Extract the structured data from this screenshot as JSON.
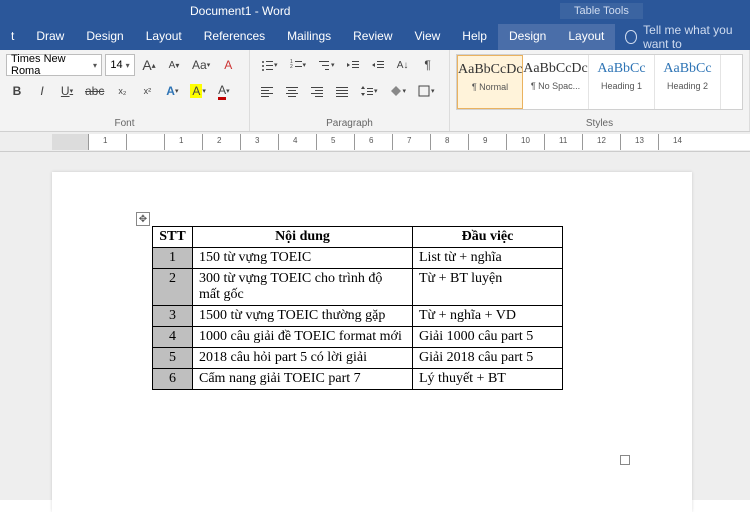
{
  "title": "Document1 - Word",
  "table_tools": "Table Tools",
  "tabs": [
    "t",
    "Draw",
    "Design",
    "Layout",
    "References",
    "Mailings",
    "Review",
    "View",
    "Help"
  ],
  "context_tabs": [
    "Design",
    "Layout"
  ],
  "tellme": "Tell me what you want to",
  "font": {
    "name": "Times New Roma",
    "size": "14",
    "grow": "A",
    "shrink": "A",
    "case": "Aa",
    "clear": "A",
    "bold": "B",
    "italic": "I",
    "underline": "U",
    "strike": "abc",
    "sub": "x₂",
    "sup": "x²",
    "effects": "A",
    "highlight": "A",
    "color": "A",
    "group_label": "Font"
  },
  "paragraph": {
    "group_label": "Paragraph"
  },
  "styles": {
    "group_label": "Styles",
    "items": [
      {
        "preview": "AaBbCcDc",
        "name": "¶ Normal"
      },
      {
        "preview": "AaBbCcDc",
        "name": "¶ No Spac..."
      },
      {
        "preview": "AaBbCc",
        "name": "Heading 1"
      },
      {
        "preview": "AaBbCc",
        "name": "Heading 2"
      }
    ]
  },
  "table": {
    "headers": [
      "STT",
      "Nội dung",
      "Đầu việc"
    ],
    "rows": [
      {
        "stt": "1",
        "nd": "150 từ vựng TOEIC",
        "dv": "List từ + nghĩa"
      },
      {
        "stt": "2",
        "nd": "300 từ vựng TOEIC cho trình độ mất gốc",
        "dv": "Từ + BT luyện"
      },
      {
        "stt": "3",
        "nd": "1500 từ vựng TOEIC thường gặp",
        "dv": "Từ + nghĩa + VD"
      },
      {
        "stt": "4",
        "nd": "1000 câu giải đề TOEIC format mới",
        "dv": "Giải 1000 câu part 5"
      },
      {
        "stt": "5",
        "nd": "2018 câu hỏi part 5 có lời giải",
        "dv": "Giải 2018 câu part 5"
      },
      {
        "stt": "6",
        "nd": "Cẩm nang giải TOEIC part 7",
        "dv": "Lý thuyết + BT"
      }
    ]
  },
  "ruler_marks": [
    "1",
    "",
    "1",
    "2",
    "3",
    "4",
    "5",
    "6",
    "7",
    "8",
    "9",
    "10",
    "11",
    "12",
    "13",
    "14"
  ]
}
